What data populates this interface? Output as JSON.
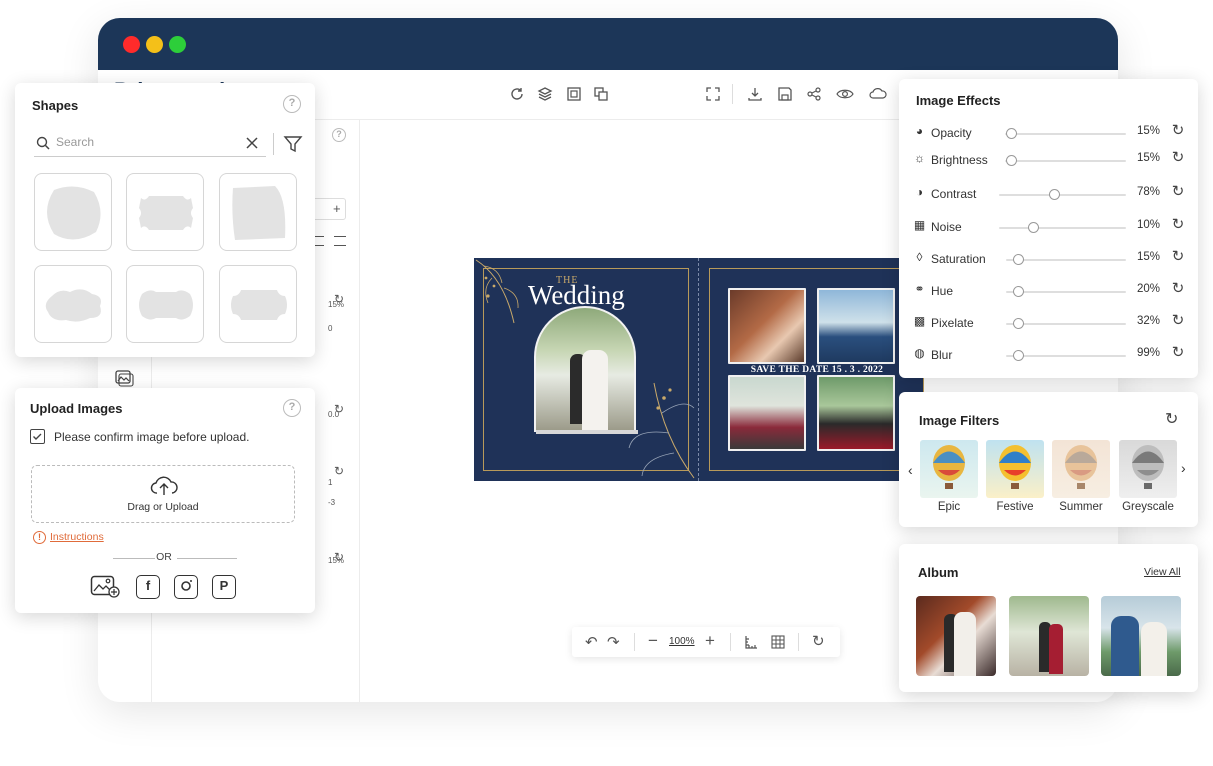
{
  "app": {
    "logo_text": "Printgrand",
    "colors": {
      "titlebar": "#1c3658",
      "accent": "#e8782a",
      "design_bg": "#1f3258",
      "gold": "#c9a96a"
    }
  },
  "window_controls": {
    "close": "#ff2b2b",
    "minimize": "#f4c019",
    "maximize": "#2dce3a"
  },
  "toolbar": {
    "icons": [
      "refresh-icon",
      "layers-icon",
      "add-frame-icon",
      "duplicate-icon",
      "fullscreen-icon",
      "download-icon",
      "save-icon",
      "share-icon",
      "preview-icon",
      "cloud-icon"
    ]
  },
  "left_panel": {
    "values": [
      "15%",
      "0",
      "0.0",
      "1",
      "-3",
      "15%"
    ]
  },
  "design": {
    "the_text": "THE",
    "title": "Wedding",
    "save_date": "SAVE THE DATE 15 . 3 . 2022"
  },
  "zoom": {
    "level": "100%"
  },
  "shapes_panel": {
    "title": "Shapes",
    "search_placeholder": "Search",
    "help": "?"
  },
  "upload_panel": {
    "title": "Upload Images",
    "help": "?",
    "confirm_label": "Please confirm image before upload.",
    "drop_label": "Drag or Upload",
    "instructions": "Instructions",
    "or": "OR"
  },
  "effects_panel": {
    "title": "Image Effects",
    "items": [
      {
        "label": "Opacity",
        "value": "15%",
        "level": 0.05,
        "icon": "opacity-icon"
      },
      {
        "label": "Brightness",
        "value": "15%",
        "level": 0.05,
        "icon": "brightness-icon"
      },
      {
        "label": "Contrast",
        "value": "78%",
        "level": 0.43,
        "icon": "contrast-icon"
      },
      {
        "label": "Noise",
        "value": "10%",
        "level": 0.27,
        "icon": "noise-icon"
      },
      {
        "label": "Saturation",
        "value": "15%",
        "level": 0.1,
        "icon": "saturation-icon"
      },
      {
        "label": "Hue",
        "value": "20%",
        "level": 0.1,
        "icon": "hue-icon"
      },
      {
        "label": "Pixelate",
        "value": "32%",
        "level": 0.1,
        "icon": "pixelate-icon"
      },
      {
        "label": "Blur",
        "value": "99%",
        "level": 0.1,
        "icon": "blur-icon"
      }
    ]
  },
  "filters_panel": {
    "title": "Image Filters",
    "items": [
      {
        "label": "Epic"
      },
      {
        "label": "Festive"
      },
      {
        "label": "Summer"
      },
      {
        "label": "Greyscale"
      }
    ]
  },
  "album_panel": {
    "title": "Album",
    "view_all": "View All"
  }
}
